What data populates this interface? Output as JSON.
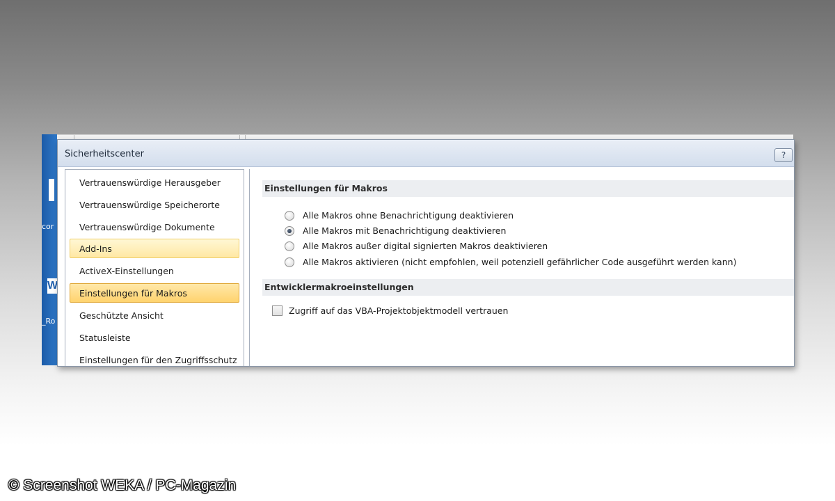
{
  "background_app": {
    "fragments": [
      "cor",
      "_Ro"
    ],
    "badge": "W"
  },
  "dialog": {
    "title": "Sicherheitscenter",
    "help_label": "?"
  },
  "nav": {
    "items": [
      {
        "label": "Vertrauenswürdige Herausgeber",
        "state": "normal"
      },
      {
        "label": "Vertrauenswürdige Speicherorte",
        "state": "normal"
      },
      {
        "label": "Vertrauenswürdige Dokumente",
        "state": "normal"
      },
      {
        "label": "Add-Ins",
        "state": "hover"
      },
      {
        "label": "ActiveX-Einstellungen",
        "state": "normal"
      },
      {
        "label": "Einstellungen für Makros",
        "state": "selected"
      },
      {
        "label": "Geschützte Ansicht",
        "state": "normal"
      },
      {
        "label": "Statusleiste",
        "state": "normal"
      },
      {
        "label": "Einstellungen für den Zugriffsschutz",
        "state": "normal"
      }
    ]
  },
  "content": {
    "macro_section_title": "Einstellungen für Makros",
    "macro_options": [
      {
        "label": "Alle Makros ohne Benachrichtigung deaktivieren",
        "checked": false
      },
      {
        "label": "Alle Makros mit Benachrichtigung deaktivieren",
        "checked": true
      },
      {
        "label": "Alle Makros außer digital signierten Makros deaktivieren",
        "checked": false
      },
      {
        "label": "Alle Makros aktivieren (nicht empfohlen, weil potenziell gefährlicher Code ausgeführt werden kann)",
        "checked": false
      }
    ],
    "dev_section_title": "Entwicklermakroeinstellungen",
    "vba_trust_label": "Zugriff auf das VBA-Projektobjektmodell vertrauen",
    "vba_trust_checked": false
  },
  "watermark": "© Screenshot WEKA / PC-Magazin",
  "colors": {
    "selected_bg": "#ffd36e",
    "hover_bg": "#ffe8a4",
    "section_head_bg": "#eceef1",
    "titlebar_bg": "#d3deed"
  }
}
